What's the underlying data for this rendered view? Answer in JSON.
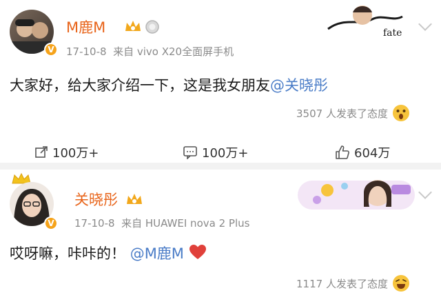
{
  "post1": {
    "username": "M鹿M",
    "time": "17-10-8",
    "source": "来自 vivo X20全面屏手机",
    "text": "大家好，给大家介绍一下，这是我女朋友",
    "mention": "@关晓彤",
    "reactions": "3507 人发表了态度"
  },
  "actions": {
    "repost": "100万+",
    "comment": "100万+",
    "like": "604万"
  },
  "post2": {
    "username": "关晓彤",
    "time": "17-10-8",
    "source": "来自 HUAWEI nova 2 Plus",
    "text": "哎呀嘛，咔咔的！",
    "mention": "@M鹿M",
    "reactions": "1117 人发表了态度"
  },
  "colors": {
    "username": "#e8641a",
    "mention": "#4a7cc7",
    "meta": "#8a8a8a",
    "verified_badge": "#f6a31a",
    "heart": "#e0403a"
  }
}
